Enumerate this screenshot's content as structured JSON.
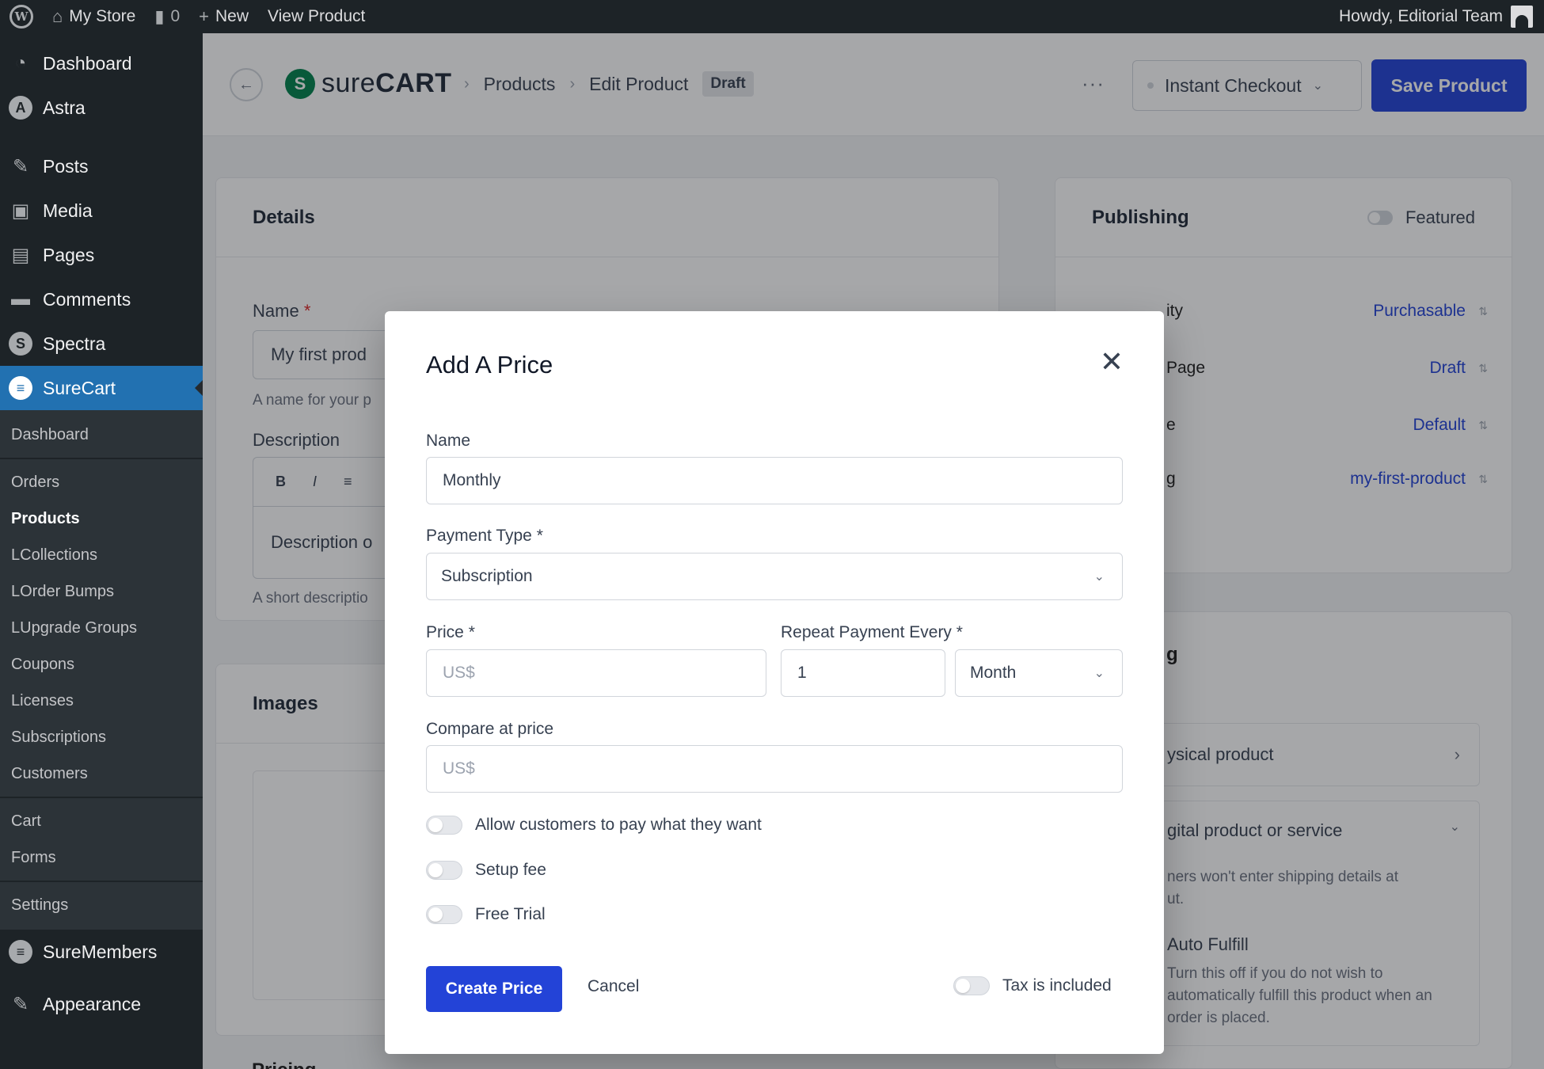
{
  "adminbar": {
    "site_name": "My Store",
    "comments_count": "0",
    "new_label": "New",
    "view_label": "View Product",
    "howdy": "Howdy, Editorial Team"
  },
  "sidebar": {
    "top_items": [
      {
        "label": "Dashboard",
        "icon": "dashboard-icon"
      },
      {
        "label": "Astra",
        "icon": "astra-icon"
      }
    ],
    "mid_items": [
      {
        "label": "Posts",
        "icon": "pin-icon"
      },
      {
        "label": "Media",
        "icon": "media-icon"
      },
      {
        "label": "Pages",
        "icon": "pages-icon"
      },
      {
        "label": "Comments",
        "icon": "comment-icon"
      },
      {
        "label": "Spectra",
        "icon": "spectra-icon"
      }
    ],
    "active_item": "SureCart",
    "submenu": {
      "group1": [
        "Dashboard"
      ],
      "group2": [
        "Orders",
        "Products",
        "Collections",
        "Order Bumps",
        "Upgrade Groups",
        "Coupons",
        "Licenses",
        "Subscriptions",
        "Customers"
      ],
      "group3": [
        "Cart",
        "Forms"
      ],
      "group4": [
        "Settings"
      ]
    },
    "bottom_items": [
      {
        "label": "SureMembers",
        "icon": "suremembers-icon"
      },
      {
        "label": "Appearance",
        "icon": "brush-icon"
      }
    ]
  },
  "topbar": {
    "logo_light": "sure",
    "logo_bold": "CART",
    "crumb_products": "Products",
    "crumb_edit": "Edit Product",
    "status_badge": "Draft",
    "more": "···",
    "checkout_label": "Instant Checkout",
    "save_label": "Save Product"
  },
  "details": {
    "title": "Details",
    "name_label": "Name",
    "name_value": "My first prod",
    "name_help": "A name for your p",
    "desc_label": "Description",
    "toolbar": [
      "B",
      "I",
      "≡"
    ],
    "desc_placeholder": "Description o",
    "desc_help": "A short descriptio"
  },
  "images": {
    "title": "Images"
  },
  "pricing_peek": "Pricing",
  "publishing": {
    "title": "Publishing",
    "featured_label": "Featured",
    "rows": [
      {
        "label": "ity",
        "value": "Purchasable"
      },
      {
        "label": "Page",
        "value": "Draft"
      },
      {
        "label": "e",
        "value": "Default"
      },
      {
        "label": "g",
        "value": "my-first-product"
      }
    ]
  },
  "shipping": {
    "title_fragment": "g",
    "physical": "ysical product",
    "digital": "gital product or service",
    "digital_desc_1": "ners won't enter shipping details at",
    "digital_desc_2": "ut.",
    "auto_title": "Auto Fulfill",
    "auto_desc_1": "Turn this off if you do not wish to",
    "auto_desc_2": "automatically fulfill this product when an",
    "auto_desc_3": "order is placed."
  },
  "modal": {
    "title": "Add A Price",
    "name_label": "Name",
    "name_value": "Monthly",
    "payment_type_label": "Payment Type",
    "payment_type_value": "Subscription",
    "price_label": "Price",
    "price_placeholder": "US$",
    "repeat_label": "Repeat Payment Every",
    "repeat_value": "1",
    "repeat_unit": "Month",
    "compare_label": "Compare at price",
    "compare_placeholder": "US$",
    "toggles": [
      "Allow customers to pay what they want",
      "Setup fee",
      "Free Trial"
    ],
    "required_mark": "*",
    "create_label": "Create Price",
    "cancel_label": "Cancel",
    "tax_label": "Tax is included"
  }
}
